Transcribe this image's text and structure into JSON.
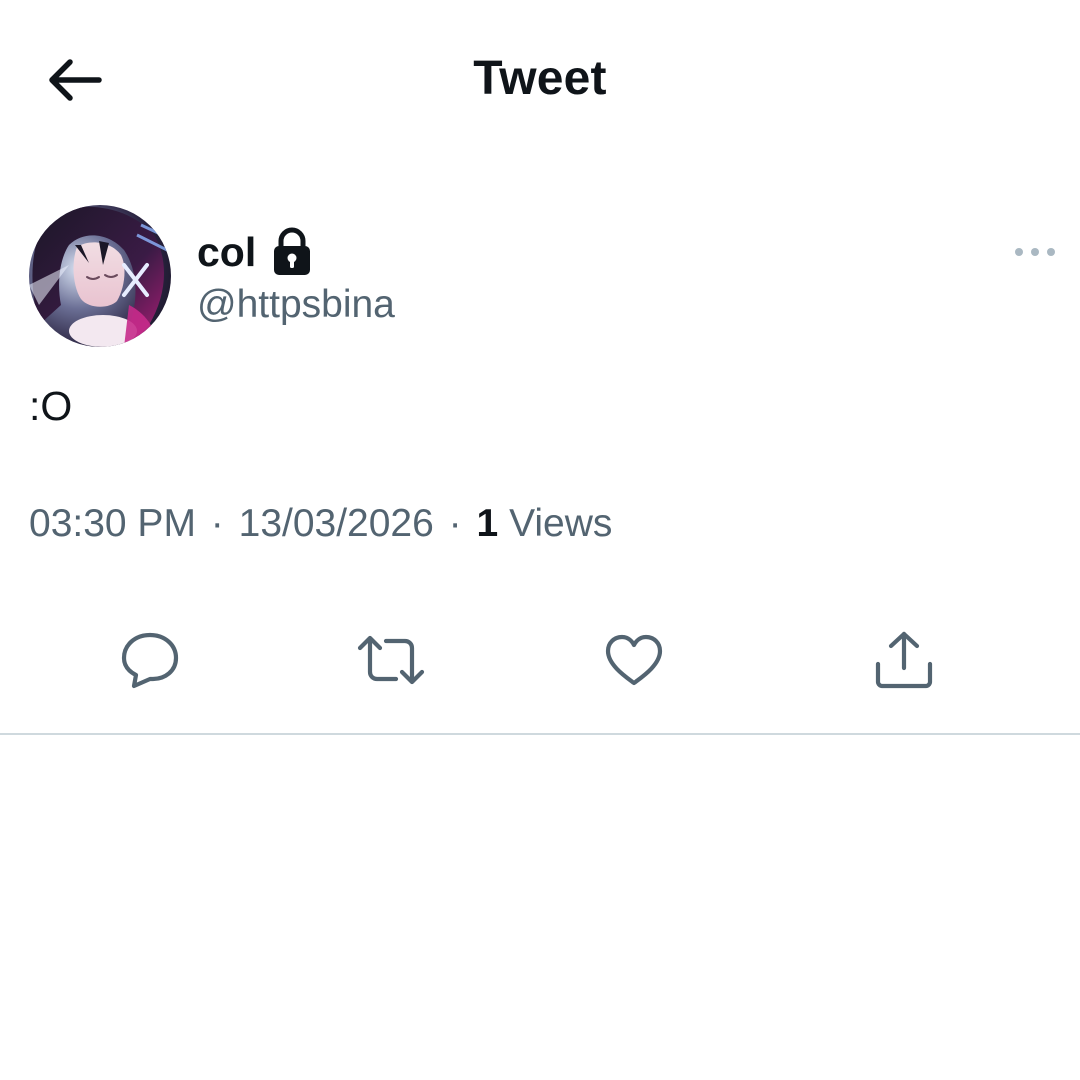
{
  "header": {
    "title": "Tweet",
    "back_icon": "arrow-left-icon"
  },
  "tweet": {
    "display_name": "col",
    "protected_icon": "lock-icon",
    "handle": "@httpsbina",
    "more_icon": "more-horizontal-icon",
    "text": ":O",
    "time": "03:30 PM",
    "date": "13/03/2026",
    "separator": "·",
    "views_count": "1",
    "views_label": "Views",
    "actions": [
      {
        "name": "reply",
        "icon": "reply-icon"
      },
      {
        "name": "retweet",
        "icon": "retweet-icon"
      },
      {
        "name": "like",
        "icon": "heart-icon"
      },
      {
        "name": "share",
        "icon": "share-icon"
      }
    ]
  },
  "colors": {
    "primary_text": "#0f1419",
    "secondary_text": "#536471",
    "icon": "#536471",
    "divider": "#cfd9de",
    "more_dots": "#aab8c2",
    "background": "#ffffff"
  }
}
